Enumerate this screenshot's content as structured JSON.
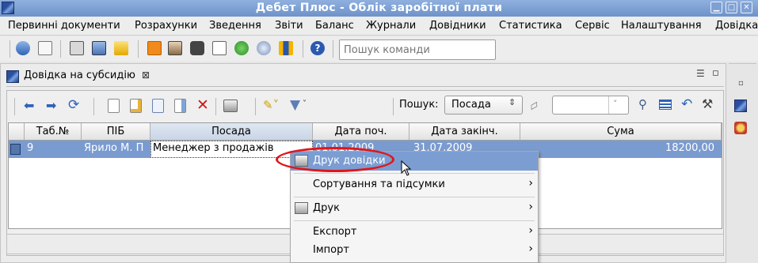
{
  "window": {
    "title": "Дебет Плюс - Облік заробітної плати",
    "buttons": [
      "▁",
      "□",
      "✕"
    ]
  },
  "menu": [
    "Первинні документи",
    "Розрахунки",
    "Зведення",
    "Звіти",
    "Баланс",
    "Журнали",
    "Довідники",
    "Статистика",
    "Сервіс",
    "Налаштування",
    "Довідка"
  ],
  "toolbar": {
    "search_placeholder": "Пошук команди",
    "help_glyph": "?"
  },
  "tab": {
    "label": "Довідка на субсидію",
    "close_glyph": "⊠",
    "menu_glyph": "☰",
    "restore_glyph": "▫"
  },
  "grid_toolbar": {
    "search_label": "Пошук:",
    "search_field_value": "Посада",
    "search_text_value": ""
  },
  "table": {
    "columns": [
      "Таб.№",
      "ПІБ",
      "Посада",
      "Дата поч.",
      "Дата закінч.",
      "Сума"
    ],
    "rows": [
      {
        "tab": "9",
        "name": "Ярило М. П",
        "position": "Менеджер з продажів",
        "start": "01.01.2009",
        "end": "31.07.2009",
        "sum": "18200,00"
      }
    ]
  },
  "context_menu": {
    "items": [
      {
        "label": "Друк довідки",
        "submenu": false,
        "highlighted": true
      },
      {
        "label": "Сортування та підсумки",
        "submenu": true
      },
      {
        "label": "Друк",
        "submenu": true
      },
      {
        "label": "Експорт",
        "submenu": true
      },
      {
        "label": "Імпорт",
        "submenu": true
      }
    ],
    "arrow_glyph": "›"
  },
  "colors": {
    "titlebar": "#7b9dd2",
    "selection": "#7a9bd0",
    "highlight_ellipse": "#e0161b"
  }
}
